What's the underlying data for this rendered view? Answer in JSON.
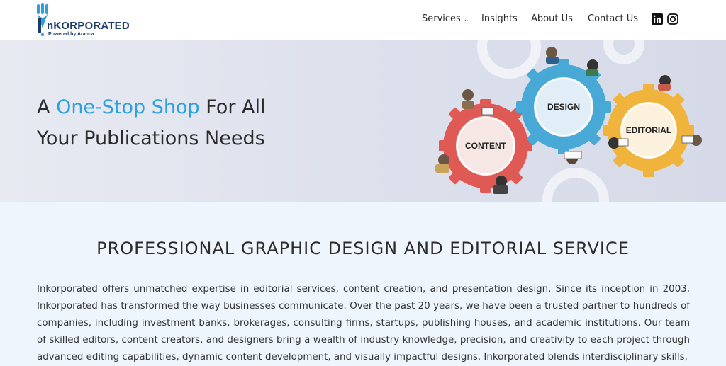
{
  "brand": {
    "name": "nKORPORATED",
    "tagline": "Powered by Aranca"
  },
  "nav": {
    "items": [
      {
        "label": "Services"
      },
      {
        "label": "Insights"
      },
      {
        "label": "About Us"
      },
      {
        "label": "Contact Us"
      }
    ],
    "social": [
      "linkedin-icon",
      "instagram-icon"
    ]
  },
  "hero": {
    "title_prefix": "A ",
    "title_accent": "One-Stop Shop",
    "title_suffix": " For All Your Publications Needs",
    "gears": {
      "content": "CONTENT",
      "design": "DESIGN",
      "editorial": "EDITORIAL"
    }
  },
  "section": {
    "title": "PROFESSIONAL GRAPHIC DESIGN AND EDITORIAL SERVICE",
    "body": "Inkorporated offers unmatched expertise in editorial services, content creation, and presentation design. Since its inception in 2003, Inkorporated has transformed the way businesses communicate. Over the past 20 years, we have been a trusted partner to hundreds of companies, including investment banks, brokerages, consulting firms, startups, publishing houses, and academic institutions. Our team of skilled editors, content creators, and designers bring a wealth of industry knowledge, precision, and creativity to each project through advanced editing capabilities, dynamic content development, and visually impactful designs. Inkorporated blends interdisciplinary skills,"
  },
  "colors": {
    "accent": "#2ba0dd",
    "brand_navy": "#1b3d6e",
    "gear_content": "#e05a55",
    "gear_design": "#49a9d6",
    "gear_editorial": "#f0b43c"
  }
}
